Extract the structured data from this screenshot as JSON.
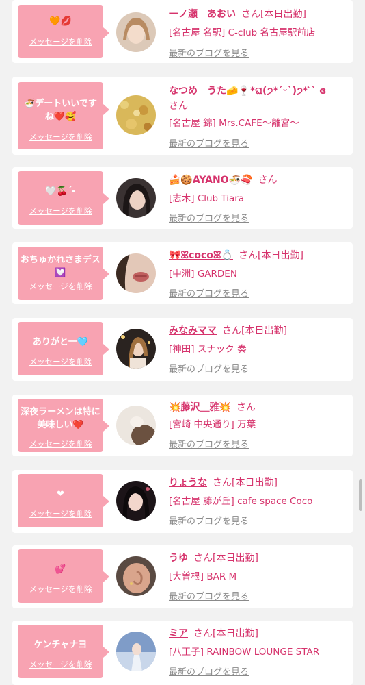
{
  "items": [
    {
      "message": "🧡💋",
      "delete_label": "メッセージを削除",
      "name": "一ノ瀬　あおい",
      "san": "さん[本日出勤]",
      "shop": "[名古屋 名駅] C-club 名古屋駅前店",
      "blog": "最新のブログを見る"
    },
    {
      "message": "🍜デートいいですね❤️🥰",
      "delete_label": "メッセージを削除",
      "name": "なつめ　うた🧀🍷*ଘ(੭*ˊᵕˋ)੭* ̀ˋ ɞ",
      "san": "さん",
      "shop": "[名古屋 錦] Mrs.CAFE～離宮～",
      "blog": "最新のブログを見る"
    },
    {
      "message": "🤍🍒´-",
      "delete_label": "メッセージを削除",
      "name": "🍰🍪AYANO🍜🍣",
      "san": "さん",
      "shop": "[志木] Club Tiara",
      "blog": "最新のブログを見る"
    },
    {
      "message": "おちゅかれさまデス💟",
      "delete_label": "メッセージを削除",
      "name": "🎀ꕤcocoꕤ💍",
      "san": "さん[本日出勤]",
      "shop": "[中洲] GARDEN",
      "blog": "最新のブログを見る"
    },
    {
      "message": "ありがと一🩵",
      "delete_label": "メッセージを削除",
      "name": "みなみママ",
      "san": "さん[本日出勤]",
      "shop": "[神田] スナック 奏",
      "blog": "最新のブログを見る"
    },
    {
      "message": "深夜ラーメンは特に美味しい❤️",
      "delete_label": "メッセージを削除",
      "name": "💥藤沢＿雅💥",
      "san": "さん",
      "shop": "[宮崎 中央通り] 万葉",
      "blog": "最新のブログを見る"
    },
    {
      "message": "❤",
      "delete_label": "メッセージを削除",
      "name": "りょうな",
      "san": "さん[本日出勤]",
      "shop": "[名古屋 藤が丘] cafe space Coco",
      "blog": "最新のブログを見る"
    },
    {
      "message": "💕",
      "delete_label": "メッセージを削除",
      "name": "うゆ",
      "san": "さん[本日出勤]",
      "shop": "[大曽根] BAR M",
      "blog": "最新のブログを見る"
    },
    {
      "message": "ケンチャナヨ",
      "delete_label": "メッセージを削除",
      "name": "ミア",
      "san": "さん[本日出勤]",
      "shop": "[八王子] RAINBOW LOUNGE STAR",
      "blog": "最新のブログを見る"
    }
  ],
  "colors": {
    "accent": "#d6336c",
    "bubble": "#f8a3b2",
    "link_gray": "#8a8a8a",
    "background": "#f2f2f2"
  }
}
